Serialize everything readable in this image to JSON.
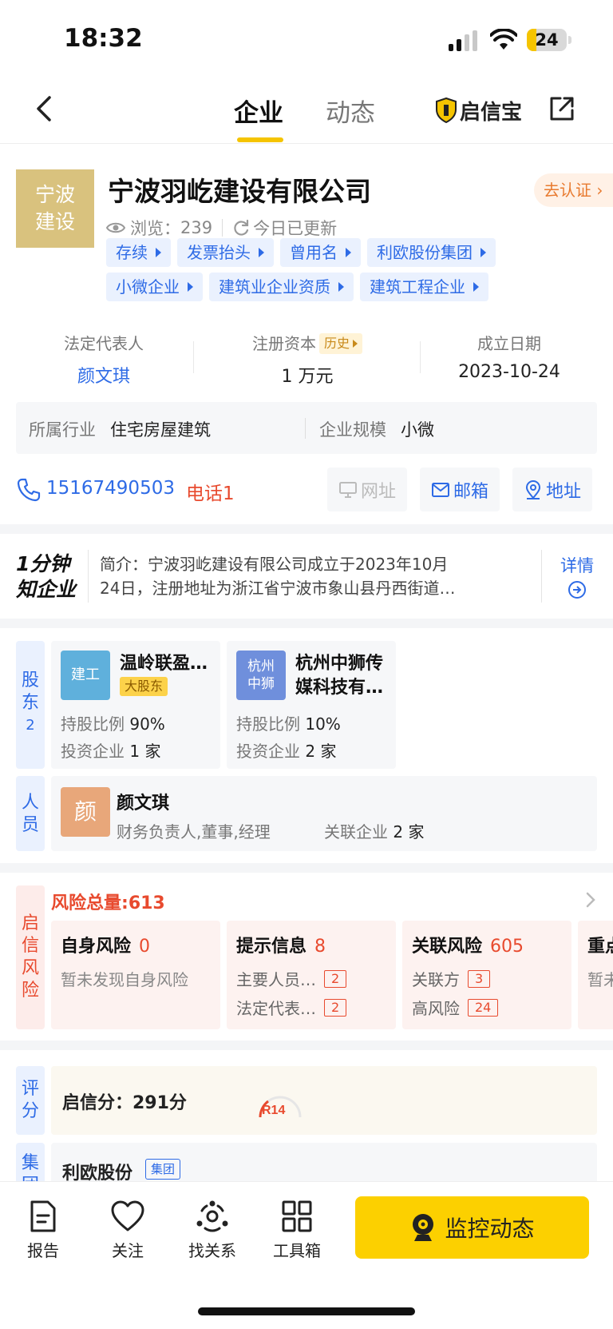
{
  "status": {
    "time": "18:32",
    "battery": "24",
    "battery_level": 0.24
  },
  "nav": {
    "tabs": [
      "企业",
      "动态"
    ],
    "brand": "启信宝"
  },
  "company": {
    "logo_text": "宁波建设",
    "logo_line1": "宁波",
    "logo_line2": "建设",
    "name": "宁波羽屹建设有限公司",
    "certify": "去认证",
    "views_label": "浏览：",
    "views": "239",
    "updated": "今日已更新",
    "tags_row1": [
      "存续",
      "发票抬头",
      "曾用名",
      "利欧股份集团"
    ],
    "tags_row2": [
      "小微企业",
      "建筑业企业资质",
      "建筑工程企业"
    ]
  },
  "basic": {
    "legal_rep_label": "法定代表人",
    "legal_rep": "颜文琪",
    "capital_label": "注册资本",
    "history": "历史",
    "capital": "1 万元",
    "founded_label": "成立日期",
    "founded": "2023-10-24",
    "industry_label": "所属行业",
    "industry": "住宅房屋建筑",
    "scale_label": "企业规模",
    "scale": "小微"
  },
  "contact": {
    "phone": "15167490503",
    "tel_label": "电话1",
    "website": "网址",
    "email": "邮箱",
    "address": "地址"
  },
  "intro": {
    "badge_line1": "1分钟",
    "badge_line2": "知企业",
    "line1": "简介：宁波羽屹建设有限公司成立于2023年10月",
    "line2": "24日，注册地址为浙江省宁波市象山县丹西街道…",
    "detail": "详情"
  },
  "shareholders": {
    "label": "股东",
    "count": "2",
    "items": [
      {
        "logo": "建工",
        "name_line1": "温岭联盈…",
        "badge": "大股东",
        "ratio_label": "持股比例",
        "ratio": "90%",
        "invest_label": "投资企业",
        "invest": "1 家"
      },
      {
        "logo_line1": "杭州",
        "logo_line2": "中狮",
        "name_line1": "杭州中狮传",
        "name_line2": "媒科技有…",
        "ratio_label": "持股比例",
        "ratio": "10%",
        "invest_label": "投资企业",
        "invest": "2 家"
      }
    ]
  },
  "personnel": {
    "label": "人员",
    "avatar": "颜",
    "name": "颜文琪",
    "roles": "财务负责人,董事,经理",
    "related_label": "关联企业",
    "related": "2 家"
  },
  "risk": {
    "label": "启信风险",
    "total_label": "风险总量:",
    "total": "613",
    "self_title": "自身风险",
    "self_count": "0",
    "self_desc": "暂未发现自身风险",
    "hint_title": "提示信息",
    "hint_count": "8",
    "hint_rows": [
      {
        "label": "主要人员…",
        "num": "2"
      },
      {
        "label": "法定代表…",
        "num": "2"
      }
    ],
    "rel_title": "关联风险",
    "rel_count": "605",
    "rel_rows": [
      {
        "label": "关联方",
        "num": "3"
      },
      {
        "label": "高风险",
        "num": "24"
      }
    ],
    "key_title": "重点",
    "key_desc": "暂未"
  },
  "score": {
    "label": "评分",
    "text": "启信分：291分",
    "rank": "R14"
  },
  "group": {
    "label": "集团",
    "name": "利欧股份",
    "tag": "集团"
  },
  "bottom": {
    "report": "报告",
    "follow": "关注",
    "relations": "找关系",
    "toolbox": "工具箱",
    "monitor": "监控动态"
  },
  "colors": {
    "accent": "#f5c400",
    "link": "#2e6be6",
    "risk": "#e84a2e"
  }
}
